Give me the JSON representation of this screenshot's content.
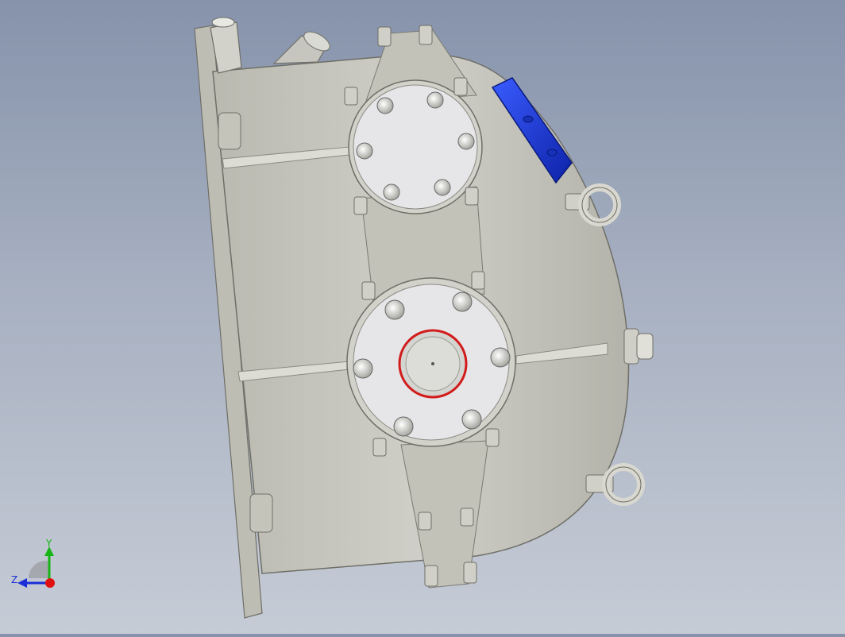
{
  "colors": {
    "background_top": "#8693ab",
    "background_bottom": "#c6ccd6",
    "housing": "#c8c8c0",
    "housing_dark": "#9d9d94",
    "cover": "#e4e4e6",
    "inspection_cover": "#1f3fd8",
    "seal_ring": "#d21b1b",
    "axis_x": "#e01010",
    "axis_y": "#16b416",
    "axis_z": "#1a2fd6"
  },
  "triad": {
    "y_label": "Y",
    "z_label": "Z"
  },
  "icons": {
    "axis_triad": "axis-triad-icon"
  }
}
